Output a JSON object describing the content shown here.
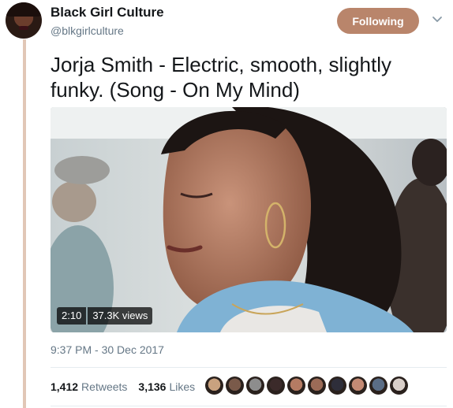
{
  "author": {
    "name": "Black Girl Culture",
    "handle": "@blkgirlculture",
    "follow_label": "Following"
  },
  "tweet": {
    "text": "Jorja Smith - Electric, smooth, slightly funky. (Song - On My Mind)",
    "timestamp": "9:37 PM - 30 Dec 2017"
  },
  "video": {
    "duration": "2:10",
    "views": "37.3K views"
  },
  "stats": {
    "retweets_count": "1,412",
    "retweets_label": "Retweets",
    "likes_count": "3,136",
    "likes_label": "Likes"
  },
  "likers": [
    {
      "color": "#c9a27f"
    },
    {
      "color": "#7a5a4a"
    },
    {
      "color": "#8d8d8d"
    },
    {
      "color": "#3b2a2a"
    },
    {
      "color": "#b57b63"
    },
    {
      "color": "#9b6b57"
    },
    {
      "color": "#2e2e3a"
    },
    {
      "color": "#c48a74"
    },
    {
      "color": "#5a6d86"
    },
    {
      "color": "#d9cfc9"
    }
  ],
  "colors": {
    "accent": "#b9856b",
    "thread_line": "#e1c7b6",
    "secondary_text": "#657786"
  },
  "icons": {
    "caret": "chevron-down-icon"
  }
}
